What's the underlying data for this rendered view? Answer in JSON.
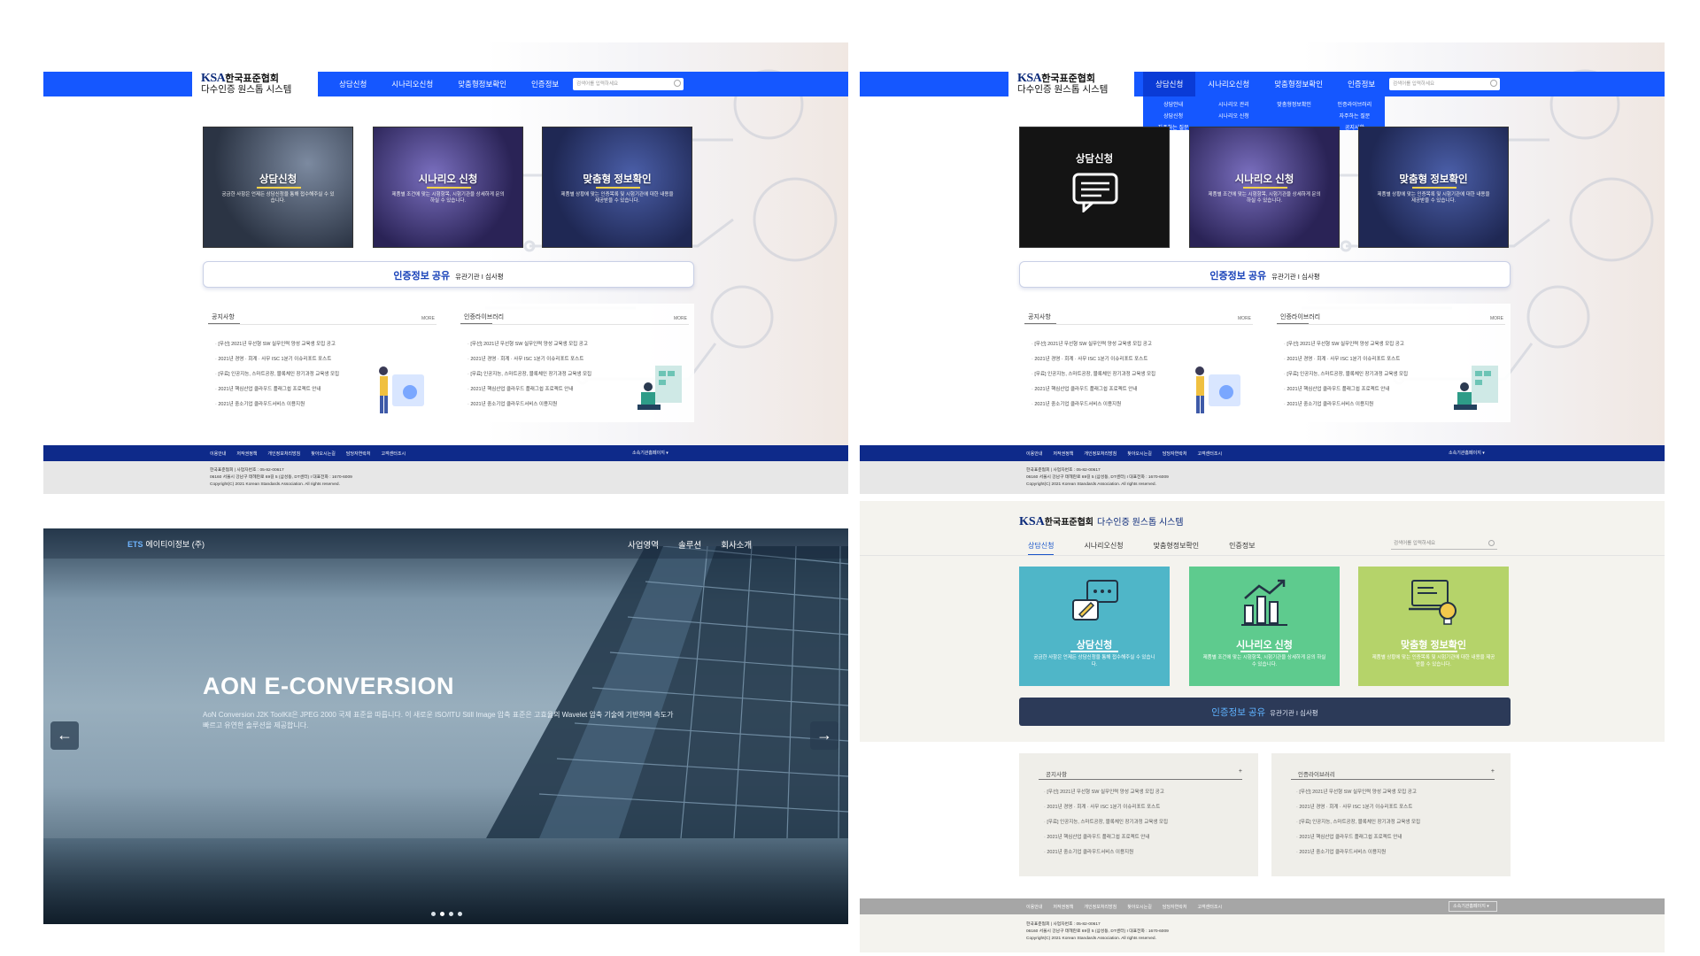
{
  "ksa": {
    "logo_ksa": "KSA",
    "logo_org": "한국표준협회",
    "logo_sub": "다수인증 원스톱 시스템",
    "nav": [
      "상담신청",
      "시나리오신청",
      "맞춤형정보확인",
      "인증정보"
    ],
    "search_placeholder": "검색어를 입력하세요",
    "dropdown": [
      [
        "상담안내",
        "상담신청",
        "자주하는 질문"
      ],
      [
        "시나리오 관리",
        "시나리오 신청"
      ],
      [
        "맞춤형정보확인"
      ],
      [
        "인증라이브러리",
        "자주하는 질문",
        "공지사항"
      ]
    ],
    "cards": [
      {
        "title": "상담신청",
        "desc": "궁금한 사항은 언제든 상담신청을 통해 접수해주실 수 있습니다."
      },
      {
        "title": "시나리오 신청",
        "desc": "제품별 조건에 맞는 시험항목, 시험기관을 상세하게 문의 하실 수 있습니다."
      },
      {
        "title": "맞춤형 정보확인",
        "desc": "제품별 상황에 맞는 인증목록 및 시험기관에 대한 내용을 제공받을 수 있습니다."
      }
    ],
    "banner_main": "인증정보 공유",
    "banner_sub": "유관기관 I 심사평",
    "board_notice_title": "공지사항",
    "board_library_title": "인증라이브러리",
    "more_label": "MORE",
    "plus_label": "+",
    "notice_items": [
      "[무선] 2021년 무선형 SW 실무인력 양성 교육생 모집 공고",
      "2021년 경영 · 회계 · 사무 ISC 1분기 이슈리포트 포스트",
      "[무료] 인공지능, 스마트공장, 블록체인 장기과정 교육생 모집",
      "2021년 핵심산업 클라우드 플래그쉽 프로젝트 안내",
      "2021년 중소기업 클라우드서비스 이용지원"
    ],
    "footer_links": [
      "이용안내",
      "저작권정책",
      "개인정보처리방침",
      "찾아오시는길",
      "담당자연락처",
      "고객센터조시"
    ],
    "footer_select": "소속기관홈페이지 ▾",
    "footer_org": "한국표준협회   |   사업자번호 : 05-82-00617",
    "footer_addr": "06160 서울시 강남구 테헤란로 69길 5 (삼성동, DT센터) I 대표전화 : 1670-6009",
    "footer_copy": "Copyright(C) 2021 Korean Standards Association. All rights reserved."
  },
  "aon": {
    "logo_mark": "ETS",
    "logo_text": "에이티이정보 (주)",
    "nav": [
      "사업영역",
      "솔루션",
      "회사소개"
    ],
    "title": "AON E-CONVERSION",
    "desc": "AoN Conversion J2K ToolKit은 JPEG 2000 국제 표준을 따릅니다. 이 새로운 ISO/ITU Still Image 압축 표준은 고효율의 Wavelet 압축 기술에 기반하며 속도가 빠르고 유연한 솔루션을 제공합니다.",
    "prev_arrow": "←",
    "next_arrow": "→",
    "slide_count": 4,
    "active_slide": 2
  }
}
